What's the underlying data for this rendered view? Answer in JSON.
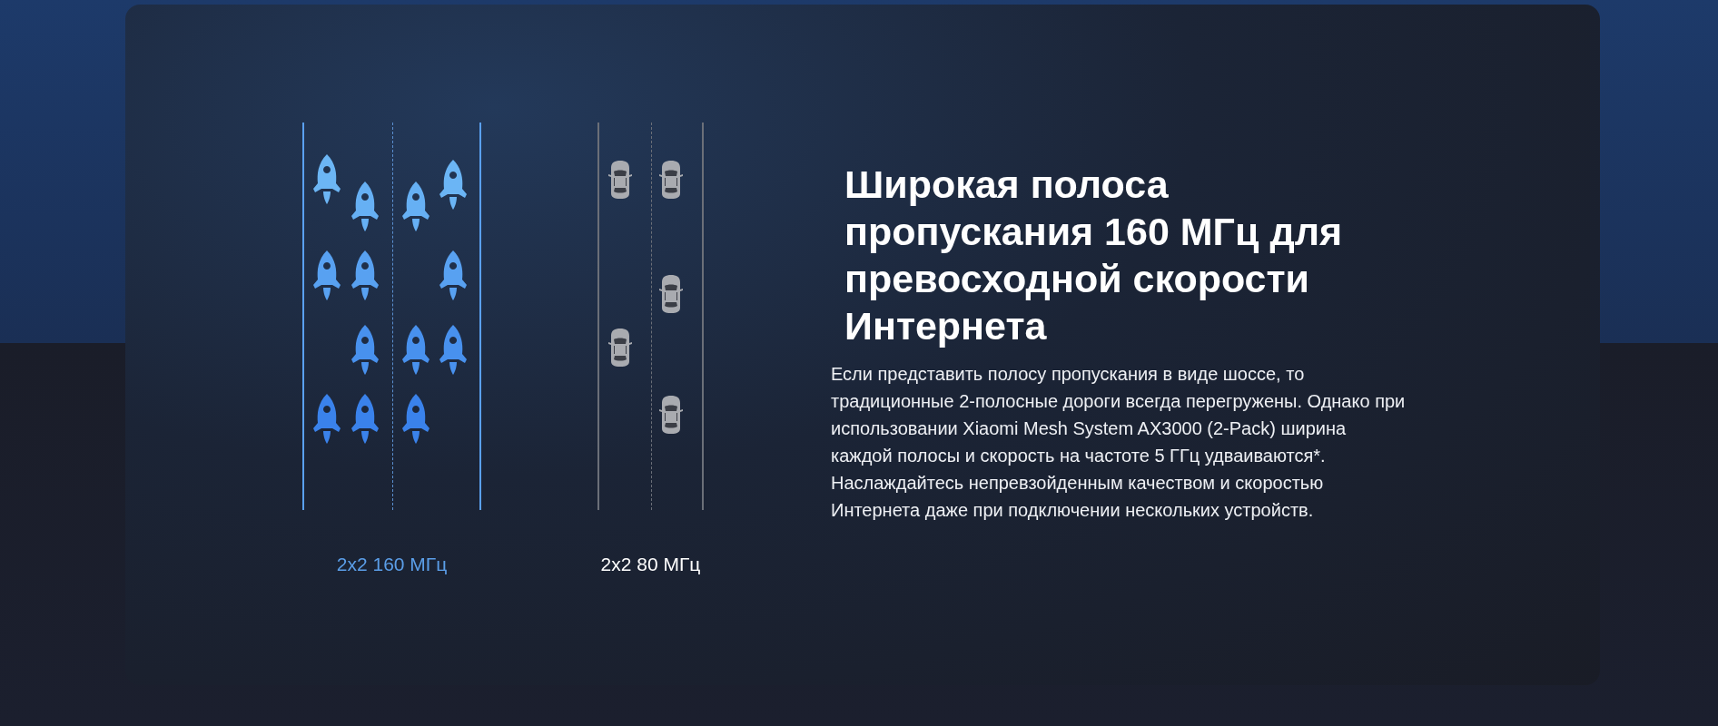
{
  "comparison": [
    {
      "kind": "rockets",
      "label": "2x2 160 МГц"
    },
    {
      "kind": "cars",
      "label": "2x2 80 МГц"
    }
  ],
  "heading": "Широкая полоса пропускания 160 МГц для превосходной скорости Интернета",
  "body": "Если представить полосу пропускания в виде шоссе, то традиционные 2-полосные дороги всегда перегружены. Однако при использовании Xiaomi Mesh System AX3000 (2-Pack) ширина каждой полосы и скорость на частоте 5 ГГц удваиваются*. Наслаждайтесь непревзойденным качеством и скоростью Интернета даже при подключении нескольких устройств."
}
